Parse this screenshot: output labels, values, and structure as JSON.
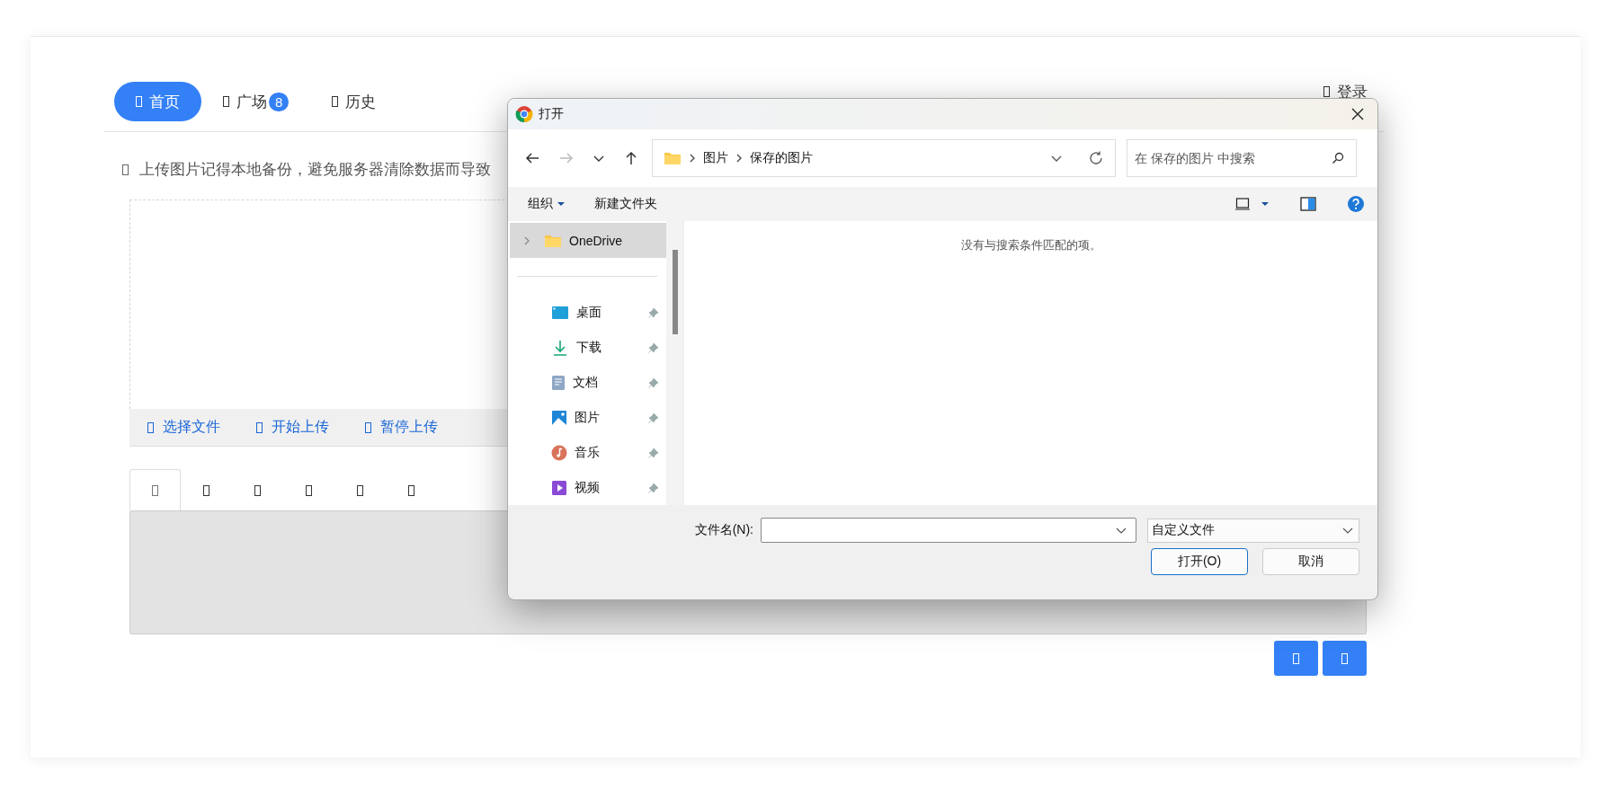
{
  "nav": {
    "tabs": [
      {
        "label": "首页",
        "selected": true
      },
      {
        "label": "广场",
        "badge": "8",
        "selected": false
      },
      {
        "label": "历史",
        "selected": false
      }
    ],
    "login": "登录"
  },
  "notice": "上传图片记得本地备份，避免服务器清除数据而导致",
  "upload_toolbar": [
    "选择文件",
    "开始上传",
    "暂停上传"
  ],
  "format_tabs": [
    {
      "selected": true
    },
    {
      "selected": false
    },
    {
      "selected": false
    },
    {
      "selected": false
    },
    {
      "selected": false
    },
    {
      "selected": false
    }
  ],
  "action_buttons": [
    {
      "kind": "icon"
    },
    {
      "kind": "icon"
    }
  ],
  "dialog": {
    "title": "打开",
    "back": {
      "disabled": false
    },
    "forward": {
      "disabled": true
    },
    "breadcrumb": [
      "图片",
      "保存的图片"
    ],
    "search": {
      "placeholder": "在 保存的图片 中搜索"
    },
    "commands": [
      "组织",
      "新建文件夹"
    ],
    "sidebar": [
      {
        "label": "OneDrive",
        "kind": "cloud",
        "selected": true,
        "expanded": false
      },
      {
        "label": "桌面",
        "kind": "desktop",
        "selected": false,
        "pinned": true
      },
      {
        "label": "下载",
        "kind": "download",
        "selected": false,
        "pinned": true
      },
      {
        "label": "文档",
        "kind": "documents",
        "selected": false,
        "pinned": true
      },
      {
        "label": "图片",
        "kind": "pictures",
        "selected": false,
        "pinned": true
      },
      {
        "label": "音乐",
        "kind": "music",
        "selected": false,
        "pinned": true
      },
      {
        "label": "视频",
        "kind": "videos",
        "selected": false,
        "pinned": true
      }
    ],
    "empty_message": "没有与搜索条件匹配的项。",
    "filename_label": "文件名(N):",
    "file_type": "自定义文件",
    "buttons": [
      {
        "label": "打开(O)",
        "kind": "primary"
      },
      {
        "label": "取消",
        "kind": "secondary"
      }
    ]
  }
}
